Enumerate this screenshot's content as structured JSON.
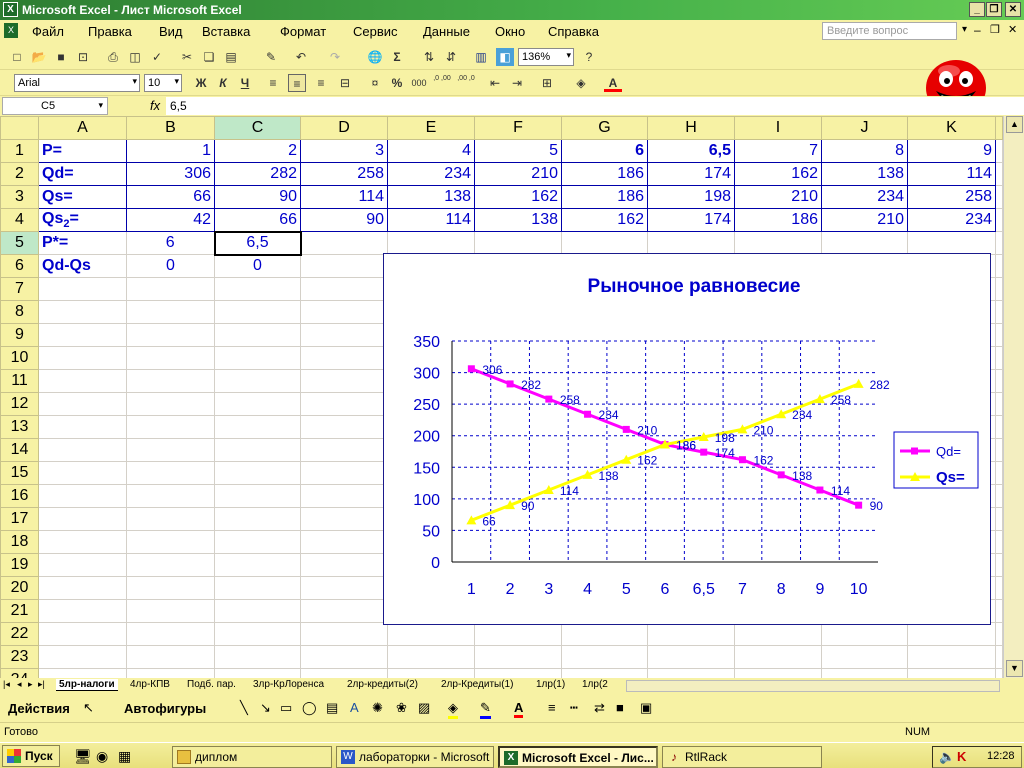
{
  "window": {
    "title": "Microsoft Excel - Лист Microsoft Excel"
  },
  "menu": {
    "items": [
      "Файл",
      "Правка",
      "Вид",
      "Вставка",
      "Формат",
      "Сервис",
      "Данные",
      "Окно",
      "Справка"
    ],
    "help_placeholder": "Введите вопрос"
  },
  "toolbar": {
    "zoom": "136%"
  },
  "format": {
    "font": "Arial",
    "size": "10",
    "bold": "Ж",
    "italic": "К",
    "underline": "Ч",
    "percent": "%",
    "thousands": "000",
    "inc_dec": ",0 ,00",
    "dec_dec": ",00 ,0"
  },
  "formula": {
    "name_box": "C5",
    "fx": "fx",
    "content": "6,5"
  },
  "sheet": {
    "columns": [
      "A",
      "B",
      "C",
      "D",
      "E",
      "F",
      "G",
      "H",
      "I",
      "J",
      "K"
    ],
    "rows": [
      "1",
      "2",
      "3",
      "4",
      "5",
      "6",
      "7",
      "8",
      "9",
      "10",
      "11",
      "12",
      "13",
      "14",
      "15",
      "16",
      "17",
      "18",
      "19",
      "20",
      "21",
      "22",
      "23",
      "24"
    ],
    "row1": {
      "label": "P=",
      "values": [
        "1",
        "2",
        "3",
        "4",
        "5",
        "6",
        "6,5",
        "7",
        "8",
        "9"
      ]
    },
    "row2": {
      "label": "Qd=",
      "values": [
        "306",
        "282",
        "258",
        "234",
        "210",
        "186",
        "174",
        "162",
        "138",
        "114"
      ]
    },
    "row3": {
      "label": "Qs=",
      "values": [
        "66",
        "90",
        "114",
        "138",
        "162",
        "186",
        "198",
        "210",
        "234",
        "258"
      ]
    },
    "row4": {
      "label": "Qs",
      "sub": "2",
      "suffix": "=",
      "values": [
        "42",
        "66",
        "90",
        "114",
        "138",
        "162",
        "174",
        "186",
        "210",
        "234"
      ]
    },
    "row5": {
      "label": "P*=",
      "b": "6",
      "c": "6,5"
    },
    "row6": {
      "label": "Qd-Qs",
      "b": "0",
      "c": "0"
    }
  },
  "chart_data": {
    "type": "line",
    "title": "Рыночное равновесие",
    "categories": [
      "1",
      "2",
      "3",
      "4",
      "5",
      "6",
      "6,5",
      "7",
      "8",
      "9",
      "10"
    ],
    "series": [
      {
        "name": "Qd=",
        "color": "#ff00ff",
        "values": [
          306,
          282,
          258,
          234,
          210,
          186,
          174,
          162,
          138,
          114,
          90
        ]
      },
      {
        "name": "Qs=",
        "color": "#ffff00",
        "values": [
          66,
          90,
          114,
          138,
          162,
          186,
          198,
          210,
          234,
          258,
          282
        ]
      }
    ],
    "ylim": [
      0,
      350
    ],
    "yticks": [
      "0",
      "50",
      "100",
      "150",
      "200",
      "250",
      "300",
      "350"
    ],
    "grid": true,
    "legend": "right"
  },
  "tabs": {
    "items": [
      "5лр-налоги",
      "4лр-КПВ",
      "Подб. пар.",
      "3лр-КрЛоренса",
      "2лр-кредиты(2)",
      "2лр-Кредиты(1)",
      "1лр(1)",
      "1лр(2"
    ]
  },
  "drawbar": {
    "actions": "Действия",
    "autoshapes": "Автофигуры"
  },
  "status": {
    "left": "Готово",
    "num": "NUM"
  },
  "taskbar": {
    "start": "Пуск",
    "tasks": [
      "диплом",
      "лабораторки - Microsoft ...",
      "Microsoft Excel - Лис...",
      "RtlRack"
    ],
    "clock": "12:28"
  }
}
